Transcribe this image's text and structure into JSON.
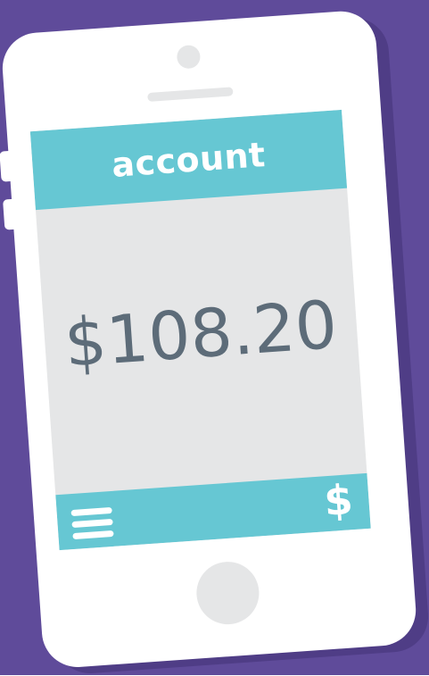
{
  "screen": {
    "header": {
      "title": "account"
    },
    "balance": "$108.20",
    "footer": {
      "menu_icon": "hamburger-menu-icon",
      "dollar_icon": "dollar-sign-icon",
      "dollar_glyph": "$"
    }
  },
  "colors": {
    "background": "#5f4b9a",
    "phone_shadow": "#4f3d86",
    "phone_body": "#ffffff",
    "accent": "#66c7d3",
    "screen": "#e5e6e7",
    "balance_text": "#5d6c79",
    "hardware_gray": "#e5e6e7"
  }
}
